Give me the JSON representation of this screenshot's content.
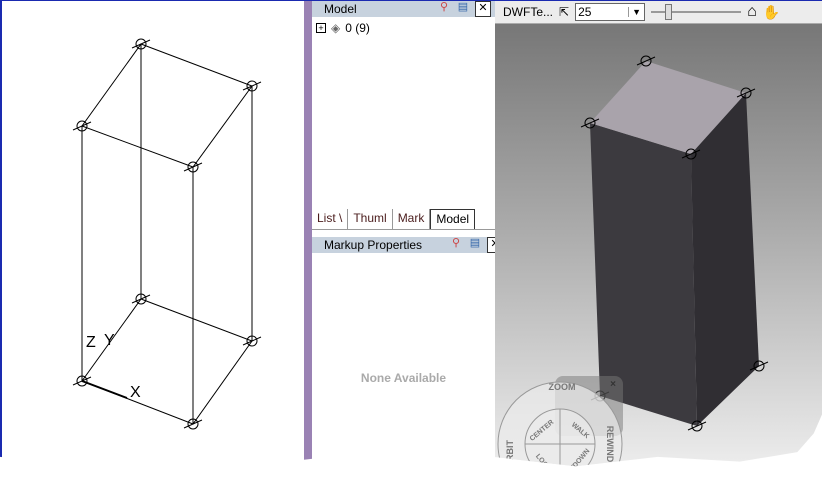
{
  "left_view": {
    "axis_labels": {
      "z": "Z",
      "y": "Y",
      "x": "X"
    }
  },
  "model_panel": {
    "title": "Model",
    "tree_item": "0 (9)",
    "icons": [
      "pin-icon",
      "properties-icon",
      "close-icon"
    ]
  },
  "tabs": [
    {
      "label": "List \\"
    },
    {
      "label": "Thuml"
    },
    {
      "label": "Mark"
    },
    {
      "label": "Model",
      "active": true
    }
  ],
  "markup_panel": {
    "title": "Markup Properties",
    "empty_text": "None Available"
  },
  "toolbar": {
    "file_label": "DWFTe...",
    "zoom_value": "25"
  },
  "steering_wheel": {
    "outer": [
      "ZOOM",
      "ORBIT",
      "REWIND"
    ],
    "inner": [
      "CENTER",
      "WALK",
      "LOOK",
      "UP/DOWN"
    ],
    "close": "×"
  },
  "colors": {
    "divider": "#9a82b4",
    "panel_header": "#c7d2de",
    "box_top": "#a9a3ab",
    "box_front": "#3c3a3f"
  }
}
